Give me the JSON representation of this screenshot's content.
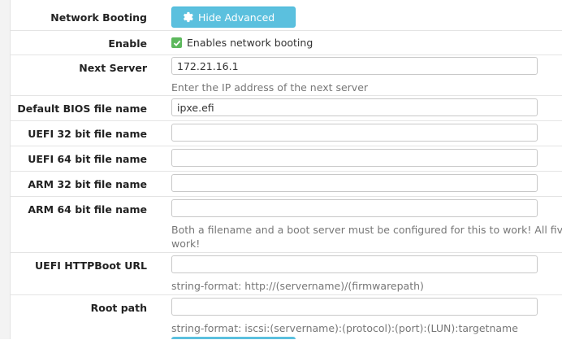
{
  "network_booting": {
    "label": "Network Booting",
    "button_label": "Hide Advanced",
    "button_icon": "gear-icon"
  },
  "enable": {
    "label": "Enable",
    "checkbox_label": "Enables network booting",
    "checked": true
  },
  "next_server": {
    "label": "Next Server",
    "value": "172.21.16.1",
    "help": "Enter the IP address of the next server"
  },
  "default_bios": {
    "label": "Default BIOS file name",
    "value": "ipxe.efi"
  },
  "uefi32": {
    "label": "UEFI 32 bit file name",
    "value": ""
  },
  "uefi64": {
    "label": "UEFI 64 bit file name",
    "value": ""
  },
  "arm32": {
    "label": "ARM 32 bit file name",
    "value": ""
  },
  "arm64": {
    "label": "ARM 64 bit file name",
    "value": "",
    "help_line1": "Both a filename and a boot server must be configured for this to work! All five fi",
    "help_line2": "work!"
  },
  "uefi_httpboot": {
    "label": "UEFI HTTPBoot URL",
    "value": "",
    "help": "string-format: http://(servername)/(firmwarepath)"
  },
  "root_path": {
    "label": "Root path",
    "value": "",
    "help": "string-format: iscsi:(servername):(protocol):(port):(LUN):targetname"
  },
  "colors": {
    "info": "#5bc0de",
    "check": "#5cb85c"
  }
}
